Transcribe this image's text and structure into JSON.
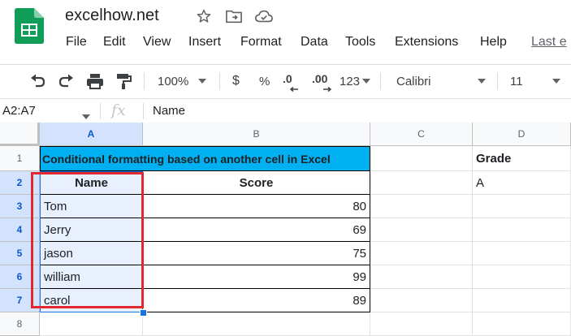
{
  "app": {
    "title": "excelhow.net",
    "menu": [
      "File",
      "Edit",
      "View",
      "Insert",
      "Format",
      "Data",
      "Tools",
      "Extensions",
      "Help"
    ],
    "last_edit": "Last e"
  },
  "toolbar": {
    "zoom": "100%",
    "currency": "$",
    "percent": "%",
    "decrease_decimal": ".0",
    "increase_decimal": ".00",
    "more_formats": "123",
    "font": "Calibri",
    "font_size": "11"
  },
  "formula_bar": {
    "name_box": "A2:A7",
    "fx": "fx",
    "content": "Name"
  },
  "grid": {
    "columns": [
      "A",
      "B",
      "C",
      "D"
    ],
    "rows": [
      "1",
      "2",
      "3",
      "4",
      "5",
      "6",
      "7",
      "8"
    ],
    "title_cell": "Conditional formatting based on another cell in Excel",
    "headers": {
      "name": "Name",
      "score": "Score"
    },
    "data": [
      {
        "name": "Tom",
        "score": "80"
      },
      {
        "name": "Jerry",
        "score": "69"
      },
      {
        "name": "jason",
        "score": "75"
      },
      {
        "name": "william",
        "score": "99"
      },
      {
        "name": "carol",
        "score": "89"
      }
    ],
    "grade_label": "Grade",
    "grade_value": "A"
  },
  "colors": {
    "title_fill": "#00b0f0",
    "selection_fill": "#e8f0fe",
    "selection_border": "#1a73e8",
    "annotation_box": "#e0282e",
    "logo_green": "#0f9d58"
  }
}
